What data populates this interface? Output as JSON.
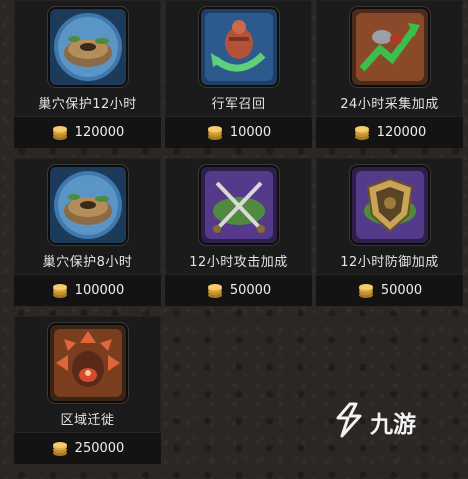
{
  "items": [
    {
      "name": "巢穴保护12小时",
      "amount": "120000",
      "icon": "nest-shield-icon"
    },
    {
      "name": "行军召回",
      "amount": "10000",
      "icon": "march-recall-icon"
    },
    {
      "name": "24小时采集加成",
      "amount": "120000",
      "icon": "gather-boost-icon"
    },
    {
      "name": "巢穴保护8小时",
      "amount": "100000",
      "icon": "nest-shield-icon"
    },
    {
      "name": "12小时攻击加成",
      "amount": "50000",
      "icon": "attack-boost-icon"
    },
    {
      "name": "12小时防御加成",
      "amount": "50000",
      "icon": "defense-boost-icon"
    },
    {
      "name": "区域迁徙",
      "amount": "250000",
      "icon": "relocation-icon"
    }
  ],
  "watermark": {
    "text": "九游"
  },
  "colors": {
    "card_bg": "#1c1b1b",
    "price_bg": "#141313",
    "text": "#e6e3df",
    "coin": "#d8a73a"
  }
}
